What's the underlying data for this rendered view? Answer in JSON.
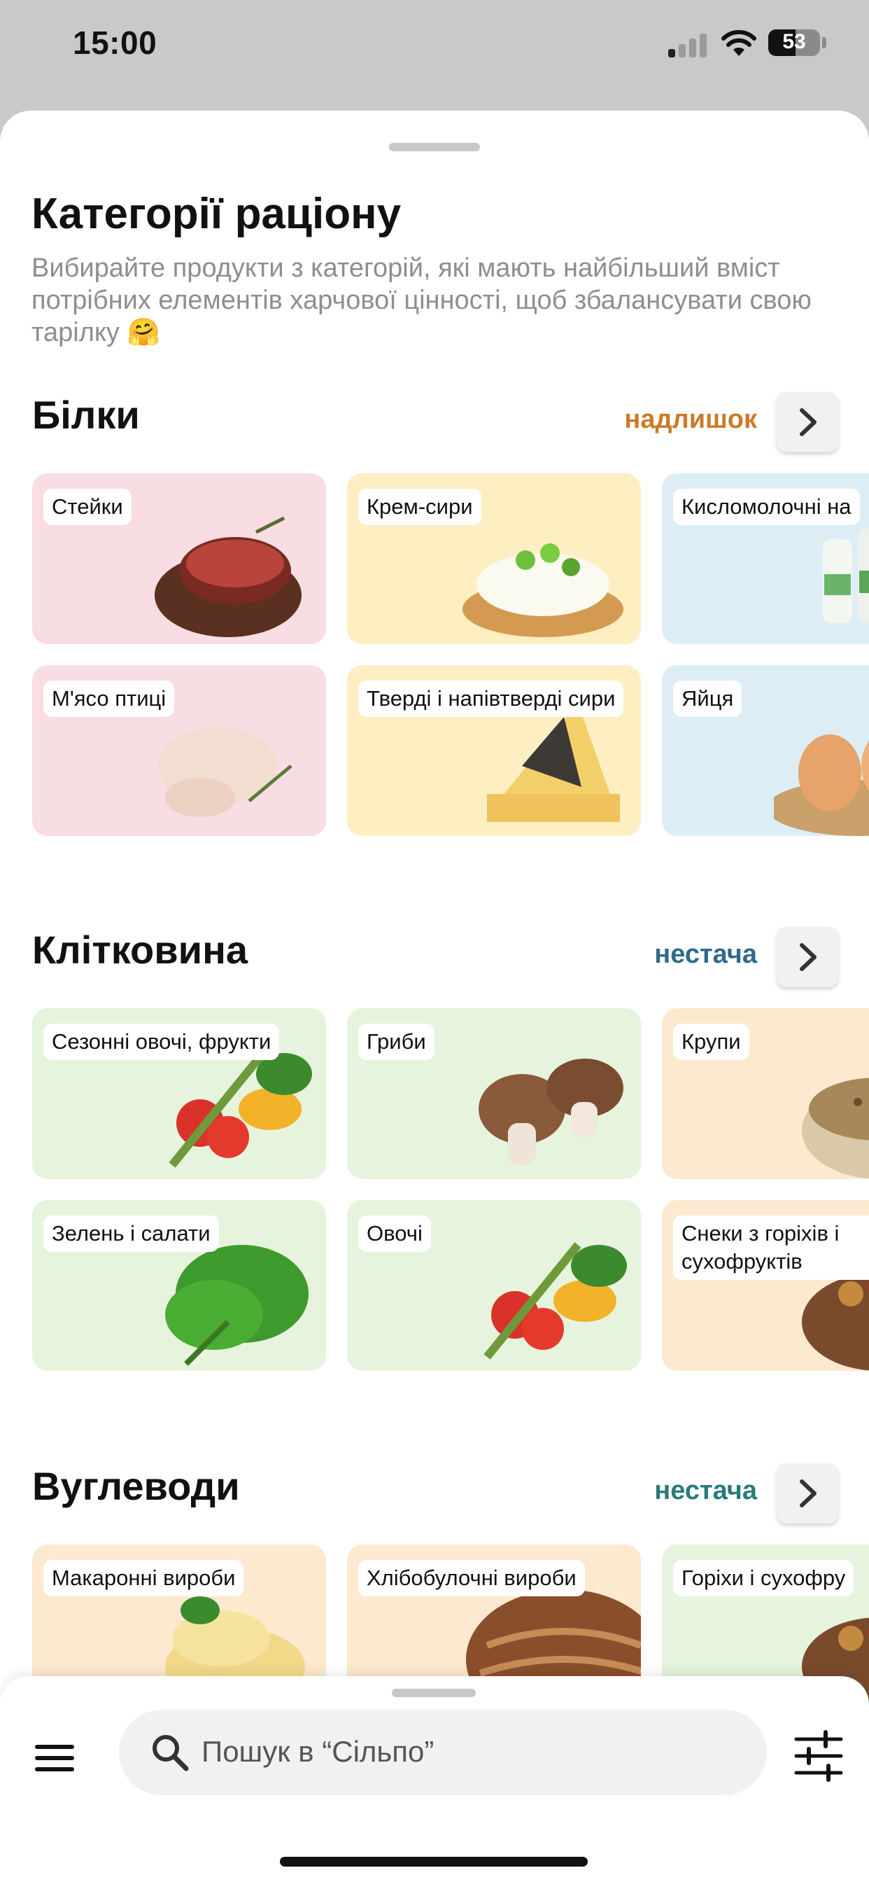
{
  "status_bar": {
    "time": "15:00",
    "battery": "53",
    "battery_level": 0.53
  },
  "header": {
    "title": "Категорії раціону",
    "subtitle": "Вибирайте продукти з категорій, які мають найбільший вміст потрібних елементів харчової цінності, щоб збалансувати свою тарілку 🤗"
  },
  "sections": [
    {
      "title": "Білки",
      "status": "надлишок",
      "status_color": "#cc7a2a",
      "cards": [
        {
          "label": "Стейки",
          "color": "pink",
          "image": "steak"
        },
        {
          "label": "Крем-сири",
          "color": "yellow",
          "image": "cream-cheese"
        },
        {
          "label": "Кисломолочні на",
          "color": "blue",
          "image": "kefir"
        },
        {
          "label": "М'ясо птиці",
          "color": "pink",
          "image": "chicken"
        },
        {
          "label": "Тверді і напівтверді сири",
          "color": "yellow",
          "image": "cheese"
        },
        {
          "label": "Яйця",
          "color": "blue",
          "image": "eggs"
        }
      ]
    },
    {
      "title": "Клітковина",
      "status": "нестача",
      "status_color": "#2e6b8a",
      "cards": [
        {
          "label": "Сезонні овочі, фрукти",
          "color": "green",
          "image": "vegetables"
        },
        {
          "label": "Гриби",
          "color": "green",
          "image": "mushrooms"
        },
        {
          "label": "Крупи",
          "color": "peach",
          "image": "grains"
        },
        {
          "label": "Зелень і салати",
          "color": "green",
          "image": "greens"
        },
        {
          "label": "Овочі",
          "color": "green",
          "image": "vegetables"
        },
        {
          "label": "Снеки з горіхів і сухофруктів",
          "color": "peach",
          "image": "nuts"
        }
      ]
    },
    {
      "title": "Вуглеводи",
      "status": "нестача",
      "status_color": "#2a7a78",
      "cards": [
        {
          "label": "Макаронні вироби",
          "color": "peach",
          "image": "pasta"
        },
        {
          "label": "Хлібобулочні вироби",
          "color": "peach",
          "image": "bread"
        },
        {
          "label": "Горіхи і сухофру",
          "color": "green",
          "image": "nuts"
        }
      ]
    }
  ],
  "bottom_bar": {
    "search_placeholder": "Пошук в “Сільпо”"
  }
}
